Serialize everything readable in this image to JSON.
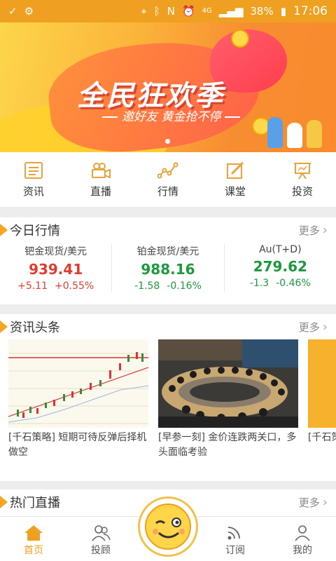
{
  "status": {
    "network": "4G",
    "battery": "38%",
    "time": "17:06"
  },
  "banner": {
    "title": "全民狂欢季",
    "subtitle": "邀好友 黄金抢不停"
  },
  "nav": [
    {
      "label": "资讯",
      "icon": "news-icon"
    },
    {
      "label": "直播",
      "icon": "video-camera-icon"
    },
    {
      "label": "行情",
      "icon": "line-chart-icon"
    },
    {
      "label": "课堂",
      "icon": "edit-icon"
    },
    {
      "label": "投资",
      "icon": "presentation-board-icon"
    }
  ],
  "market": {
    "title": "今日行情",
    "more": "更多",
    "quotes": [
      {
        "name": "钯金现货/美元",
        "price": "939.41",
        "change": "+5.11",
        "pct": "+0.55%",
        "color": "#e23b2e"
      },
      {
        "name": "铂金现货/美元",
        "price": "988.16",
        "change": "-1.58",
        "pct": "-0.16%",
        "color": "#1a9a3c"
      },
      {
        "name": "Au(T+D)",
        "price": "279.62",
        "change": "-1.3",
        "pct": "-0.46%",
        "color": "#1a9a3c"
      }
    ]
  },
  "headlines": {
    "title": "资讯头条",
    "more": "更多",
    "items": [
      {
        "text": "[千石策略] 短期可待反弹后择机做空"
      },
      {
        "text": "[早参一刻] 金价连跌两关口，多头面临考验"
      },
      {
        "text": "[千石策略] 低"
      }
    ]
  },
  "live": {
    "title": "热门直播",
    "more": "更多"
  },
  "tabs": [
    {
      "label": "首页",
      "icon": "home-icon",
      "active": true
    },
    {
      "label": "投顾",
      "icon": "advisors-icon",
      "active": false
    },
    {
      "label": "",
      "icon": "wink-face-icon",
      "active": false
    },
    {
      "label": "订阅",
      "icon": "rss-icon",
      "active": false
    },
    {
      "label": "我的",
      "icon": "user-icon",
      "active": false
    }
  ],
  "colors": {
    "accent": "#f0a020",
    "up": "#e23b2e",
    "down": "#1a9a3c"
  }
}
